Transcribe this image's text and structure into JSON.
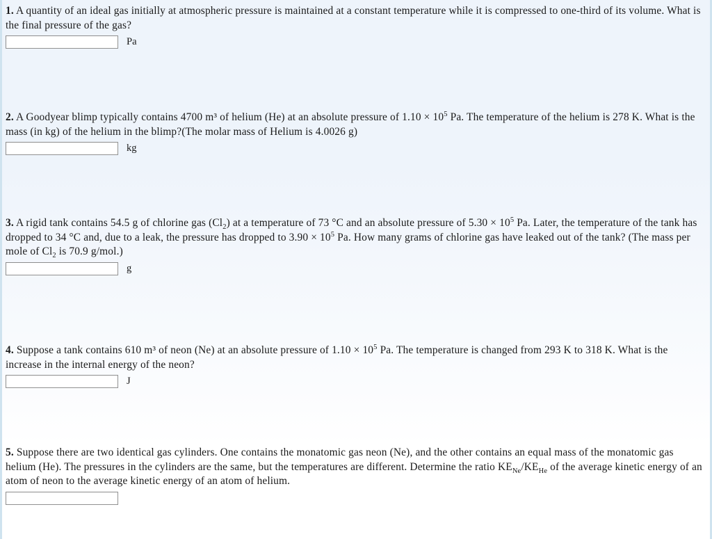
{
  "page": {
    "background_top_color": "#eef4fb",
    "background_bottom_color": "#ffffff",
    "side_border_color": "#cfe3ef",
    "text_color": "#1a1a1a",
    "input_border_color": "#919191",
    "input_background_color": "#ffffff"
  },
  "questions": [
    {
      "number": "1.",
      "text_part_1": " A quantity of an ideal gas initially at atmospheric pressure is maintained at a constant temperature while it is compressed to one-third of its volume. What is the final pressure of the gas?",
      "answer_value": "",
      "answer_placeholder": "",
      "unit": "Pa"
    },
    {
      "number": "2.",
      "text_part_1": " A Goodyear blimp typically contains 4700 m³ of helium (He) at an absolute pressure of 1.10 × 10",
      "exponent_1": "5",
      "text_part_2": " Pa. The temperature of the helium is 278 K. What is the mass (in kg) of the helium in the blimp?(The molar mass of Helium is 4.0026 g)",
      "answer_value": "",
      "answer_placeholder": "",
      "unit": "kg"
    },
    {
      "number": "3.",
      "text_part_1": " A rigid tank contains 54.5 g of chlorine gas (Cl",
      "sub_1": "2",
      "text_part_2": ") at a temperature of 73 °C and an absolute pressure of 5.30 × 10",
      "exponent_1": "5",
      "text_part_3": " Pa. Later, the temperature of the tank has dropped to 34 °C and, due to a leak, the pressure has dropped to 3.90 × 10",
      "exponent_2": "5",
      "text_part_4": " Pa. How many grams of chlorine gas have leaked out of the tank? (The mass per mole of Cl",
      "sub_2": "2",
      "text_part_5": " is 70.9 g/mol.)",
      "answer_value": "",
      "answer_placeholder": "",
      "unit": "g"
    },
    {
      "number": "4.",
      "text_part_1": " Suppose a tank contains 610 m³ of neon (Ne) at an absolute pressure of 1.10 × 10",
      "exponent_1": "5",
      "text_part_2": " Pa. The temperature is changed from 293 K to 318 K. What is the increase in the internal energy of the neon?",
      "answer_value": "",
      "answer_placeholder": "",
      "unit": "J"
    },
    {
      "number": "5.",
      "text_part_1": " Suppose there are two identical gas cylinders. One contains the monatomic gas neon (Ne), and the other contains an equal mass of the monatomic gas helium (He). The pressures in the cylinders are the same, but the temperatures are different. Determine the ratio KE",
      "sub_1": "Ne",
      "text_part_2": "/KE",
      "sub_2": "He",
      "text_part_3": " of the average kinetic energy of an atom of neon to the average kinetic energy of an atom of helium.",
      "answer_value": "",
      "answer_placeholder": "",
      "unit": ""
    }
  ]
}
